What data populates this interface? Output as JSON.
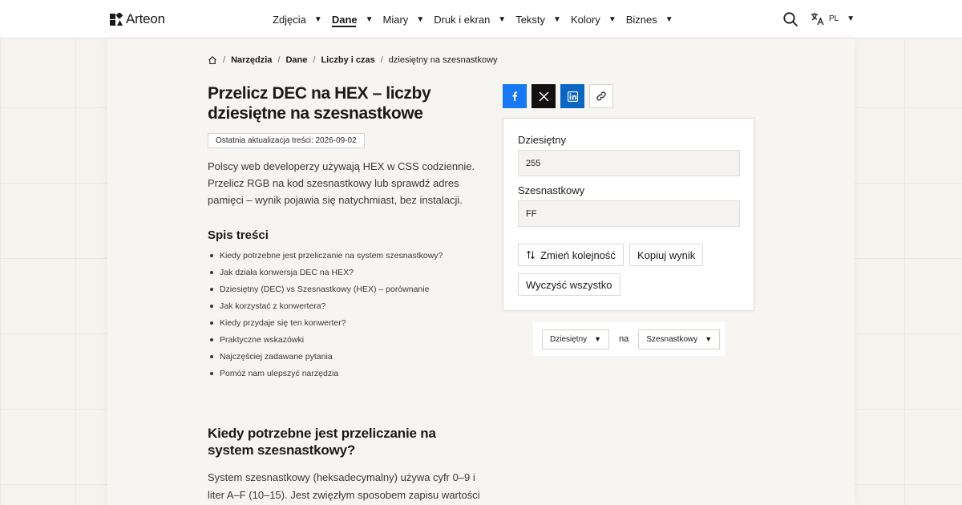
{
  "header": {
    "logo_text": "Arteon",
    "nav": [
      {
        "label": "Zdjęcia",
        "active": false
      },
      {
        "label": "Dane",
        "active": true
      },
      {
        "label": "Miary",
        "active": false
      },
      {
        "label": "Druk i ekran",
        "active": false
      },
      {
        "label": "Teksty",
        "active": false
      },
      {
        "label": "Kolory",
        "active": false
      },
      {
        "label": "Biznes",
        "active": false
      }
    ],
    "lang": "PL",
    "icons": {
      "search": "search-icon",
      "translate": "translate-icon",
      "caret": "▼"
    }
  },
  "breadcrumb": {
    "items": [
      "Narzędzia",
      "Dane",
      "Liczby i czas"
    ],
    "current": "dziesiętny na szesnastkowy",
    "separator": "/"
  },
  "article": {
    "title": "Przelicz DEC na HEX – liczby dziesiętne na szesnastkowe",
    "updated": "Ostatnia aktualizacja treści: 2026-09-02",
    "intro": "Polscy web developerzy używają HEX w CSS codziennie. Przelicz RGB na kod szesnastkowy lub sprawdź adres pamięci – wynik pojawia się natychmiast, bez instalacji.",
    "toc_title": "Spis treści",
    "toc": [
      "Kiedy potrzebne jest przeliczanie na system szesnastkowy?",
      "Jak działa konwersja DEC na HEX?",
      "Dziesiętny (DEC) vs Szesnastkowy (HEX) – porównanie",
      "Jak korzystać z konwertera?",
      "Kiedy przydaje się ten konwerter?",
      "Praktyczne wskazówki",
      "Najczęściej zadawane pytania",
      "Pomóż nam ulepszyć narzędzia"
    ],
    "section_title": "Kiedy potrzebne jest przeliczanie na system szesnastkowy?",
    "section_body": "System szesnastkowy (heksadecymalny) używa cyfr 0–9 i liter A–F (10–15). Jest zwięzłym sposobem zapisu wartości"
  },
  "share": {
    "icons": [
      "facebook-icon",
      "x-icon",
      "linkedin-icon",
      "link-icon"
    ],
    "colors": {
      "facebook": "#1877f2",
      "x": "#111111",
      "linkedin": "#0a66c2"
    }
  },
  "converter": {
    "decimal_label": "Dziesiętny",
    "decimal_value": "255",
    "hex_label": "Szesnastkowy",
    "hex_value": "FF",
    "swap_label": "Zmień kolejność",
    "copy_label": "Kopiuj wynik",
    "clear_label": "Wyczyść wszystko"
  },
  "selector": {
    "from": "Dziesiętny",
    "connector": "na",
    "to": "Szesnastkowy"
  }
}
